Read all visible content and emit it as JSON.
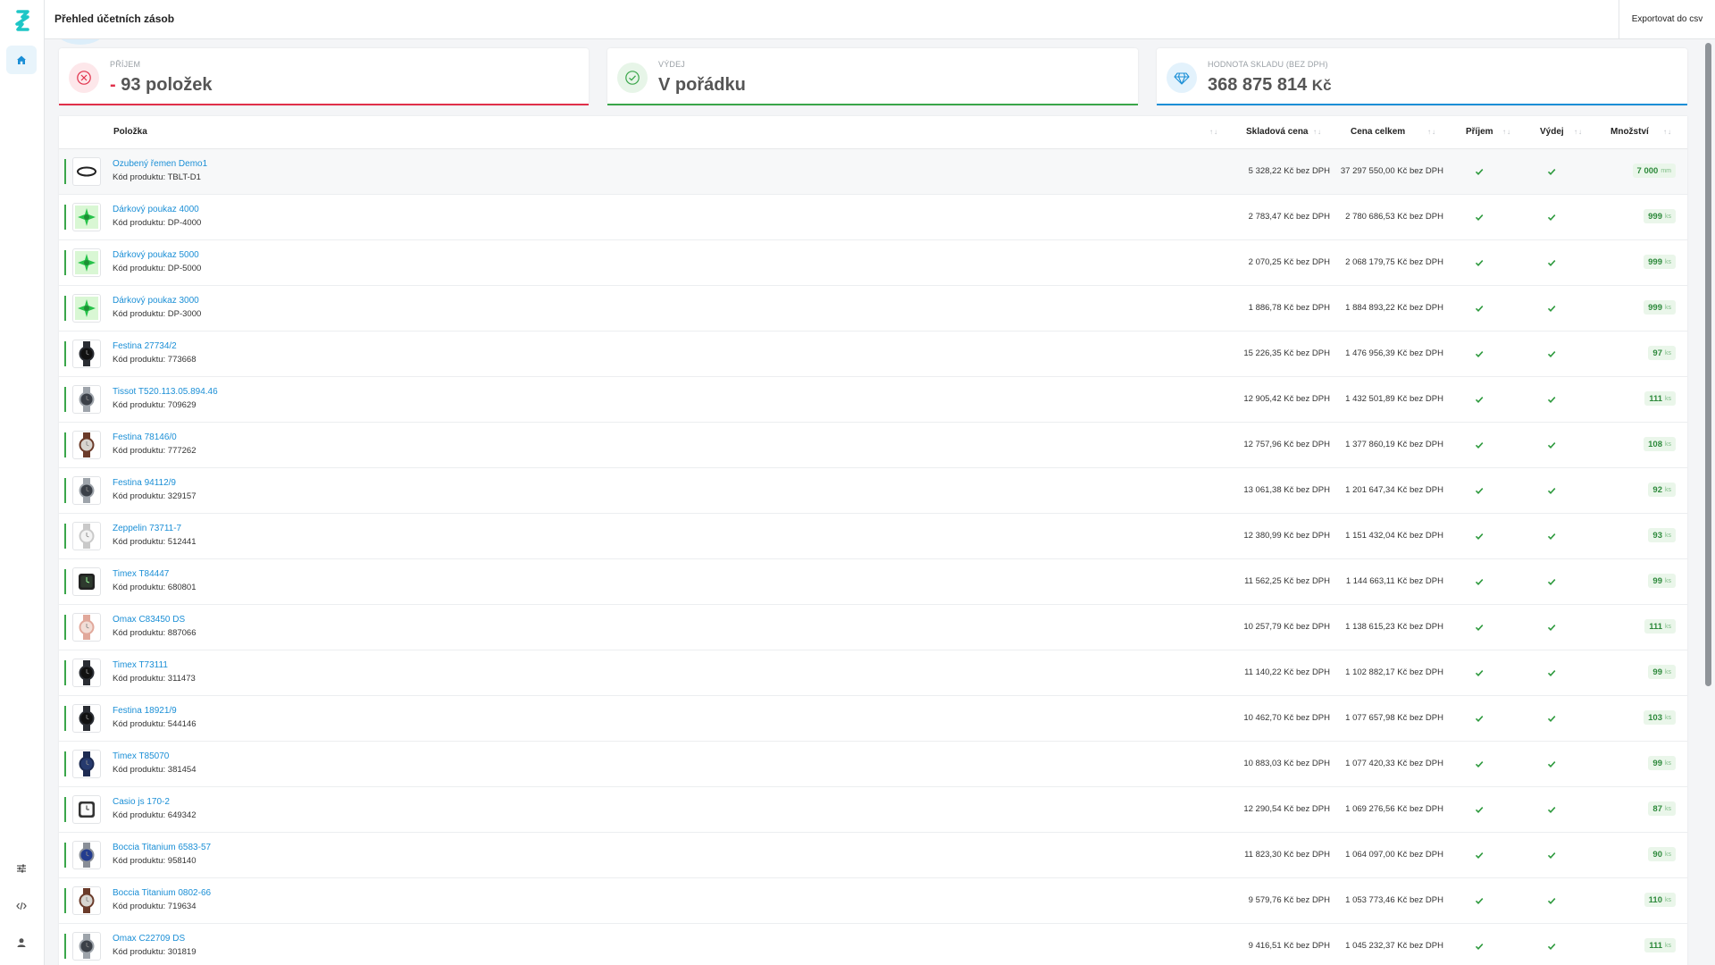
{
  "app": {
    "page_title": "Přehled účetních zásob",
    "export_label": "Exportovat do csv"
  },
  "colors": {
    "accent": "#1b8fd6",
    "danger": "#e0304a",
    "success": "#3aa64a",
    "info": "#1b8fd6"
  },
  "sidebar": {
    "top_items": [
      {
        "icon": "home-icon",
        "active": true
      }
    ],
    "bottom_items": [
      {
        "icon": "sliders-icon"
      },
      {
        "icon": "code-icon"
      },
      {
        "icon": "user-icon"
      }
    ]
  },
  "cards": [
    {
      "label": "Příjem",
      "sign": "-",
      "value": "93 položek",
      "icon": "x-circle-icon",
      "color": "#e0304a"
    },
    {
      "label": "Výdej",
      "value": "V pořádku",
      "icon": "check-circle-icon",
      "color": "#3aa64a"
    },
    {
      "label": "Hodnota skladu (bez DPH)",
      "value": "368 875 814",
      "unit": "Kč",
      "icon": "diamond-icon",
      "color": "#1b8fd6"
    }
  ],
  "table": {
    "columns": {
      "item": "Položka",
      "stock_price": "Skladová cena",
      "total_price": "Cena celkem",
      "receipt": "Příjem",
      "issue": "Výdej",
      "quantity": "Množství"
    },
    "rows": [
      {
        "name": "Ozubený řemen Demo1",
        "code": "Kód produktu: TBLT-D1",
        "stock_price": "5 328,22 Kč bez DPH",
        "total_price": "37 297 550,00 Kč bez DPH",
        "qty": "7 000",
        "unit": "mm",
        "thumb": "belt"
      },
      {
        "name": "Dárkový poukaz 4000",
        "code": "Kód produktu: DP-4000",
        "stock_price": "2 783,47 Kč bez DPH",
        "total_price": "2 780 686,53 Kč bez DPH",
        "qty": "999",
        "unit": "ks",
        "thumb": "voucher"
      },
      {
        "name": "Dárkový poukaz 5000",
        "code": "Kód produktu: DP-5000",
        "stock_price": "2 070,25 Kč bez DPH",
        "total_price": "2 068 179,75 Kč bez DPH",
        "qty": "999",
        "unit": "ks",
        "thumb": "voucher"
      },
      {
        "name": "Dárkový poukaz 3000",
        "code": "Kód produktu: DP-3000",
        "stock_price": "1 886,78 Kč bez DPH",
        "total_price": "1 884 893,22 Kč bez DPH",
        "qty": "999",
        "unit": "ks",
        "thumb": "voucher"
      },
      {
        "name": "Festina 27734/2",
        "code": "Kód produktu: 773668",
        "stock_price": "15 226,35 Kč bez DPH",
        "total_price": "1 476 956,39 Kč bez DPH",
        "qty": "97",
        "unit": "ks",
        "thumb": "watch-black"
      },
      {
        "name": "Tissot T520.113.05.894.46",
        "code": "Kód produktu: 709629",
        "stock_price": "12 905,42 Kč bez DPH",
        "total_price": "1 432 501,89 Kč bez DPH",
        "qty": "111",
        "unit": "ks",
        "thumb": "watch-steel"
      },
      {
        "name": "Festina 78146/0",
        "code": "Kód produktu: 777262",
        "stock_price": "12 757,96 Kč bez DPH",
        "total_price": "1 377 860,19 Kč bez DPH",
        "qty": "108",
        "unit": "ks",
        "thumb": "watch-brown"
      },
      {
        "name": "Festina 94112/9",
        "code": "Kód produktu: 329157",
        "stock_price": "13 061,38 Kč bez DPH",
        "total_price": "1 201 647,34 Kč bez DPH",
        "qty": "92",
        "unit": "ks",
        "thumb": "watch-steel"
      },
      {
        "name": "Zeppelin 73711-7",
        "code": "Kód produktu: 512441",
        "stock_price": "12 380,99 Kč bez DPH",
        "total_price": "1 151 432,04 Kč bez DPH",
        "qty": "93",
        "unit": "ks",
        "thumb": "watch-white"
      },
      {
        "name": "Timex T84447",
        "code": "Kód produktu: 680801",
        "stock_price": "11 562,25 Kč bez DPH",
        "total_price": "1 144 663,11 Kč bez DPH",
        "qty": "99",
        "unit": "ks",
        "thumb": "watch-square"
      },
      {
        "name": "Omax C83450 DS",
        "code": "Kód produktu: 887066",
        "stock_price": "10 257,79 Kč bez DPH",
        "total_price": "1 138 615,23 Kč bez DPH",
        "qty": "111",
        "unit": "ks",
        "thumb": "watch-pink"
      },
      {
        "name": "Timex T73111",
        "code": "Kód produktu: 311473",
        "stock_price": "11 140,22 Kč bez DPH",
        "total_price": "1 102 882,17 Kč bez DPH",
        "qty": "99",
        "unit": "ks",
        "thumb": "watch-black"
      },
      {
        "name": "Festina 18921/9",
        "code": "Kód produktu: 544146",
        "stock_price": "10 462,70 Kč bez DPH",
        "total_price": "1 077 657,98 Kč bez DPH",
        "qty": "103",
        "unit": "ks",
        "thumb": "watch-black"
      },
      {
        "name": "Timex T85070",
        "code": "Kód produktu: 381454",
        "stock_price": "10 883,03 Kč bez DPH",
        "total_price": "1 077 420,33 Kč bez DPH",
        "qty": "99",
        "unit": "ks",
        "thumb": "watch-navy"
      },
      {
        "name": "Casio js 170-2",
        "code": "Kód produktu: 649342",
        "stock_price": "12 290,54 Kč bez DPH",
        "total_price": "1 069 276,56 Kč bez DPH",
        "qty": "87",
        "unit": "ks",
        "thumb": "watch-square-white"
      },
      {
        "name": "Boccia Titanium 6583-57",
        "code": "Kód produktu: 958140",
        "stock_price": "11 823,30 Kč bez DPH",
        "total_price": "1 064 097,00 Kč bez DPH",
        "qty": "90",
        "unit": "ks",
        "thumb": "watch-blue"
      },
      {
        "name": "Boccia Titanium 0802-66",
        "code": "Kód produktu: 719634",
        "stock_price": "9 579,76 Kč bez DPH",
        "total_price": "1 053 773,46 Kč bez DPH",
        "qty": "110",
        "unit": "ks",
        "thumb": "watch-brown"
      },
      {
        "name": "Omax C22709 DS",
        "code": "Kód produktu: 301819",
        "stock_price": "9 416,51 Kč bez DPH",
        "total_price": "1 045 232,37 Kč bez DPH",
        "qty": "111",
        "unit": "ks",
        "thumb": "watch-steel"
      }
    ]
  }
}
